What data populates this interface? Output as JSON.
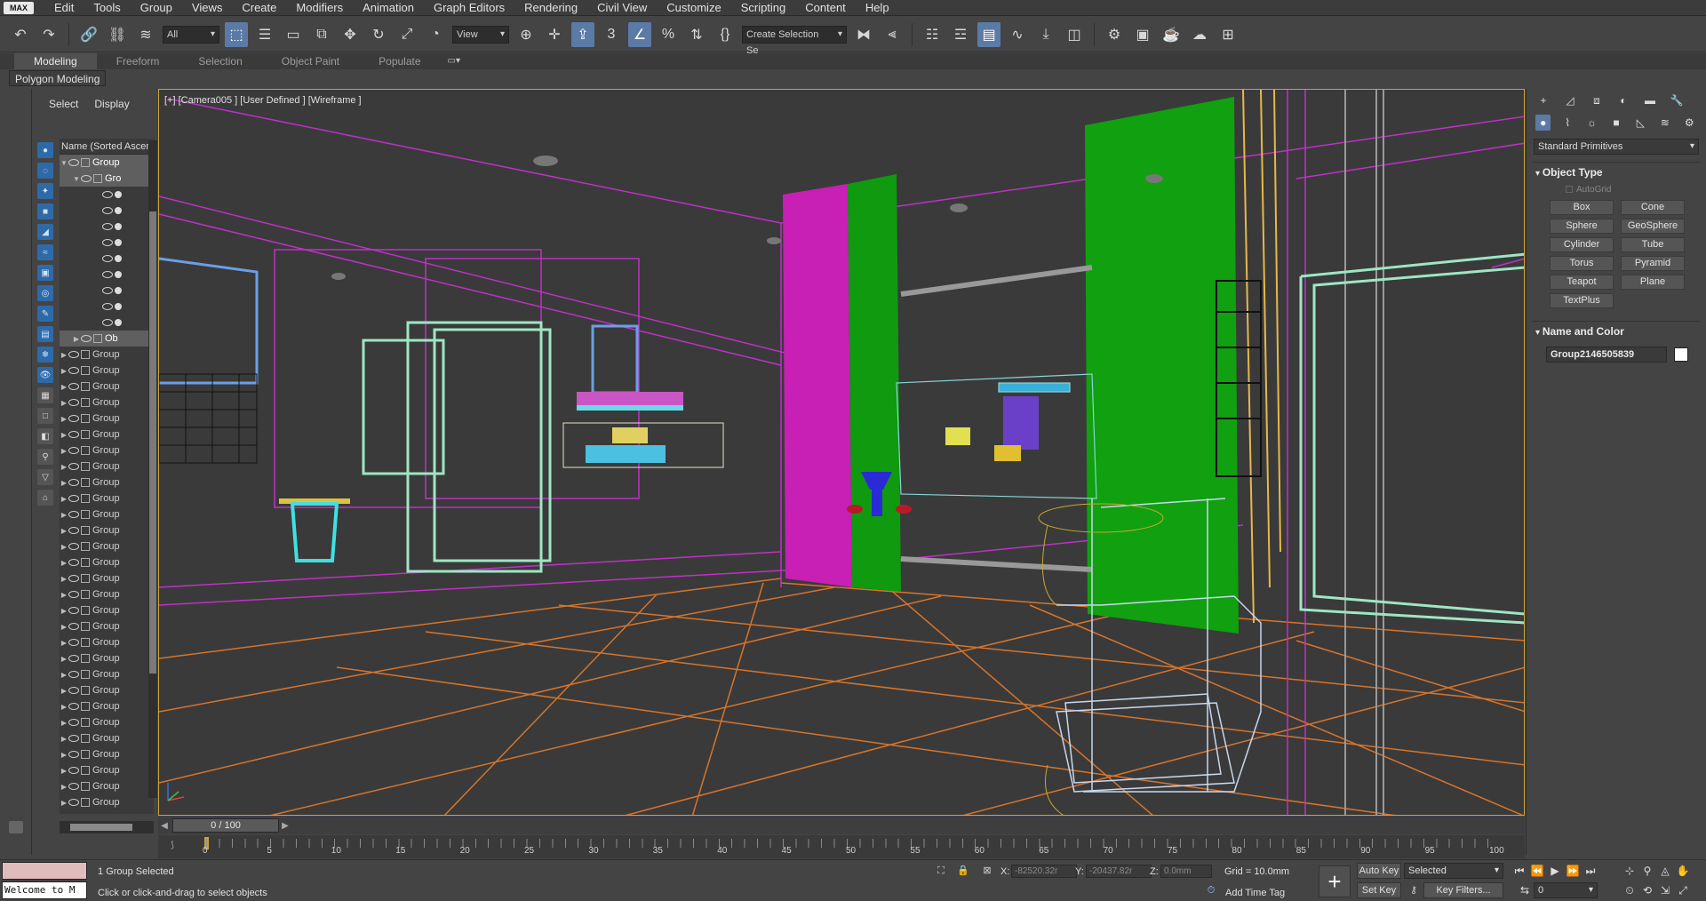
{
  "menubar": {
    "logo": "MAX",
    "items": [
      "Edit",
      "Tools",
      "Group",
      "Views",
      "Create",
      "Modifiers",
      "Animation",
      "Graph Editors",
      "Rendering",
      "Civil View",
      "Customize",
      "Scripting",
      "Content",
      "Help"
    ]
  },
  "toolbar": {
    "filter_value": "All",
    "view_value": "View",
    "selection_set_value": "Create Selection Se"
  },
  "ribbon": {
    "tabs": [
      "Modeling",
      "Freeform",
      "Selection",
      "Object Paint",
      "Populate"
    ],
    "active_tab": "Modeling",
    "panel_label": "Polygon Modeling"
  },
  "explorer": {
    "tabs": [
      "Select",
      "Display"
    ],
    "column_header": "Name (Sorted Ascen",
    "rows": [
      {
        "label": "Group",
        "level": 0,
        "expanded": true,
        "selected": true
      },
      {
        "label": "Gro",
        "level": 1,
        "expanded": true,
        "selected": true
      },
      {
        "label": "",
        "level": 2
      },
      {
        "label": "",
        "level": 2
      },
      {
        "label": "",
        "level": 2
      },
      {
        "label": "",
        "level": 2
      },
      {
        "label": "",
        "level": 2
      },
      {
        "label": "",
        "level": 2
      },
      {
        "label": "",
        "level": 2
      },
      {
        "label": "",
        "level": 2
      },
      {
        "label": "",
        "level": 2
      },
      {
        "label": "Ob",
        "level": 1,
        "selected": true
      },
      {
        "label": "Group",
        "level": 0
      },
      {
        "label": "Group",
        "level": 0
      },
      {
        "label": "Group",
        "level": 0
      },
      {
        "label": "Group",
        "level": 0
      },
      {
        "label": "Group",
        "level": 0
      },
      {
        "label": "Group",
        "level": 0
      },
      {
        "label": "Group",
        "level": 0
      },
      {
        "label": "Group",
        "level": 0
      },
      {
        "label": "Group",
        "level": 0
      },
      {
        "label": "Group",
        "level": 0
      },
      {
        "label": "Group",
        "level": 0
      },
      {
        "label": "Group",
        "level": 0
      },
      {
        "label": "Group",
        "level": 0
      },
      {
        "label": "Group",
        "level": 0
      },
      {
        "label": "Group",
        "level": 0
      },
      {
        "label": "Group",
        "level": 0
      },
      {
        "label": "Group",
        "level": 0
      },
      {
        "label": "Group",
        "level": 0
      },
      {
        "label": "Group",
        "level": 0
      },
      {
        "label": "Group",
        "level": 0
      },
      {
        "label": "Group",
        "level": 0
      },
      {
        "label": "Group",
        "level": 0
      },
      {
        "label": "Group",
        "level": 0
      },
      {
        "label": "Group",
        "level": 0
      },
      {
        "label": "Group",
        "level": 0
      },
      {
        "label": "Group",
        "level": 0
      },
      {
        "label": "Group",
        "level": 0
      },
      {
        "label": "Group",
        "level": 0
      },
      {
        "label": "Group",
        "level": 0
      }
    ]
  },
  "viewport": {
    "label": "[+] [Camera005 ] [User Defined ] [Wireframe ]",
    "border_color": "#c9a33b"
  },
  "command_panel": {
    "category_dropdown": "Standard Primitives",
    "object_type_title": "Object Type",
    "autogrid_label": "AutoGrid",
    "primitives": [
      "Box",
      "Cone",
      "Sphere",
      "GeoSphere",
      "Cylinder",
      "Tube",
      "Torus",
      "Pyramid",
      "Teapot",
      "Plane",
      "TextPlus"
    ],
    "name_color_title": "Name and Color",
    "object_name": "Group2146505839",
    "object_color": "#ffffff"
  },
  "timeline": {
    "frame_display": "0 / 100",
    "tick_labels": [
      "0",
      "5",
      "10",
      "15",
      "20",
      "25",
      "30",
      "35",
      "40",
      "45",
      "50",
      "55",
      "60",
      "65",
      "70",
      "75",
      "80",
      "85",
      "90",
      "95",
      "100"
    ]
  },
  "status": {
    "selection_text": "1 Group Selected",
    "prompt_text": "Click or click-and-drag to select objects",
    "maxscript_text": "Welcome to M",
    "x_label": "X:",
    "x_value": "-82520.32r",
    "y_label": "Y:",
    "y_value": "-20437.82r",
    "z_label": "Z:",
    "z_value": "0.0mm",
    "grid_text": "Grid = 10.0mm",
    "add_time_tag": "Add Time Tag",
    "auto_key": "Auto Key",
    "set_key": "Set Key",
    "key_mode_value": "Selected",
    "key_filters": "Key Filters...",
    "current_frame": "0"
  }
}
